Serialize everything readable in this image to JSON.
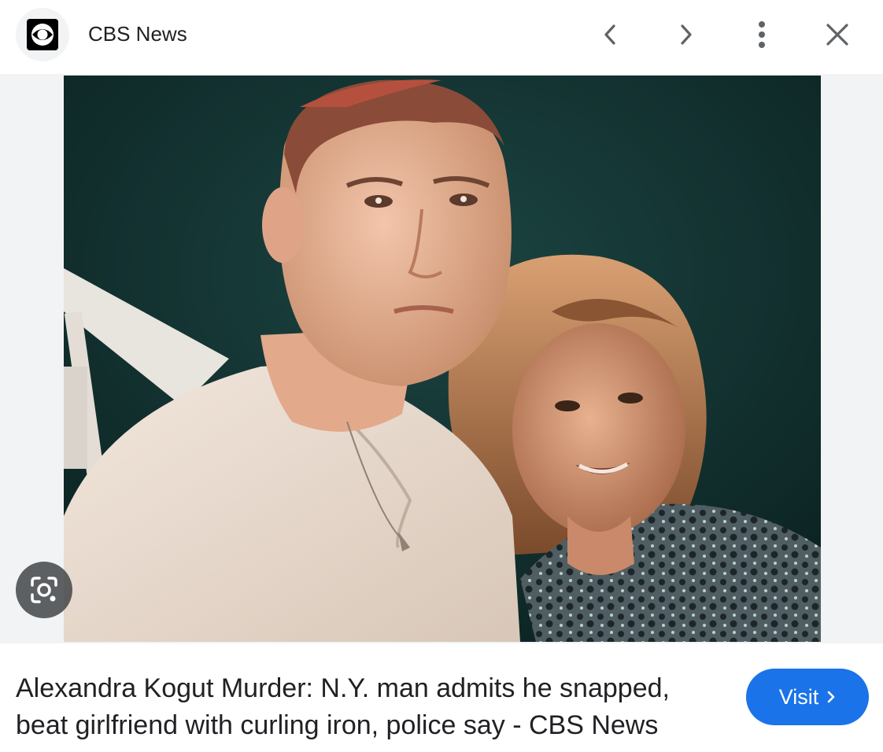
{
  "header": {
    "source_name": "CBS News",
    "logo_icon": "cbs-eye-logo",
    "nav": {
      "prev_icon": "chevron-left-icon",
      "next_icon": "chevron-right-icon",
      "more_icon": "more-vert-icon",
      "close_icon": "close-icon"
    }
  },
  "image": {
    "lens_icon": "google-lens-icon",
    "background_color": "#f1f3f4"
  },
  "result": {
    "headline": "Alexandra Kogut Murder: N.Y. man admits he snapped, beat girlfriend with curling iron, police say - CBS News",
    "visit_label": "Visit"
  },
  "colors": {
    "accent": "#1a73e8",
    "text": "#202124",
    "icon": "#5f6368"
  }
}
